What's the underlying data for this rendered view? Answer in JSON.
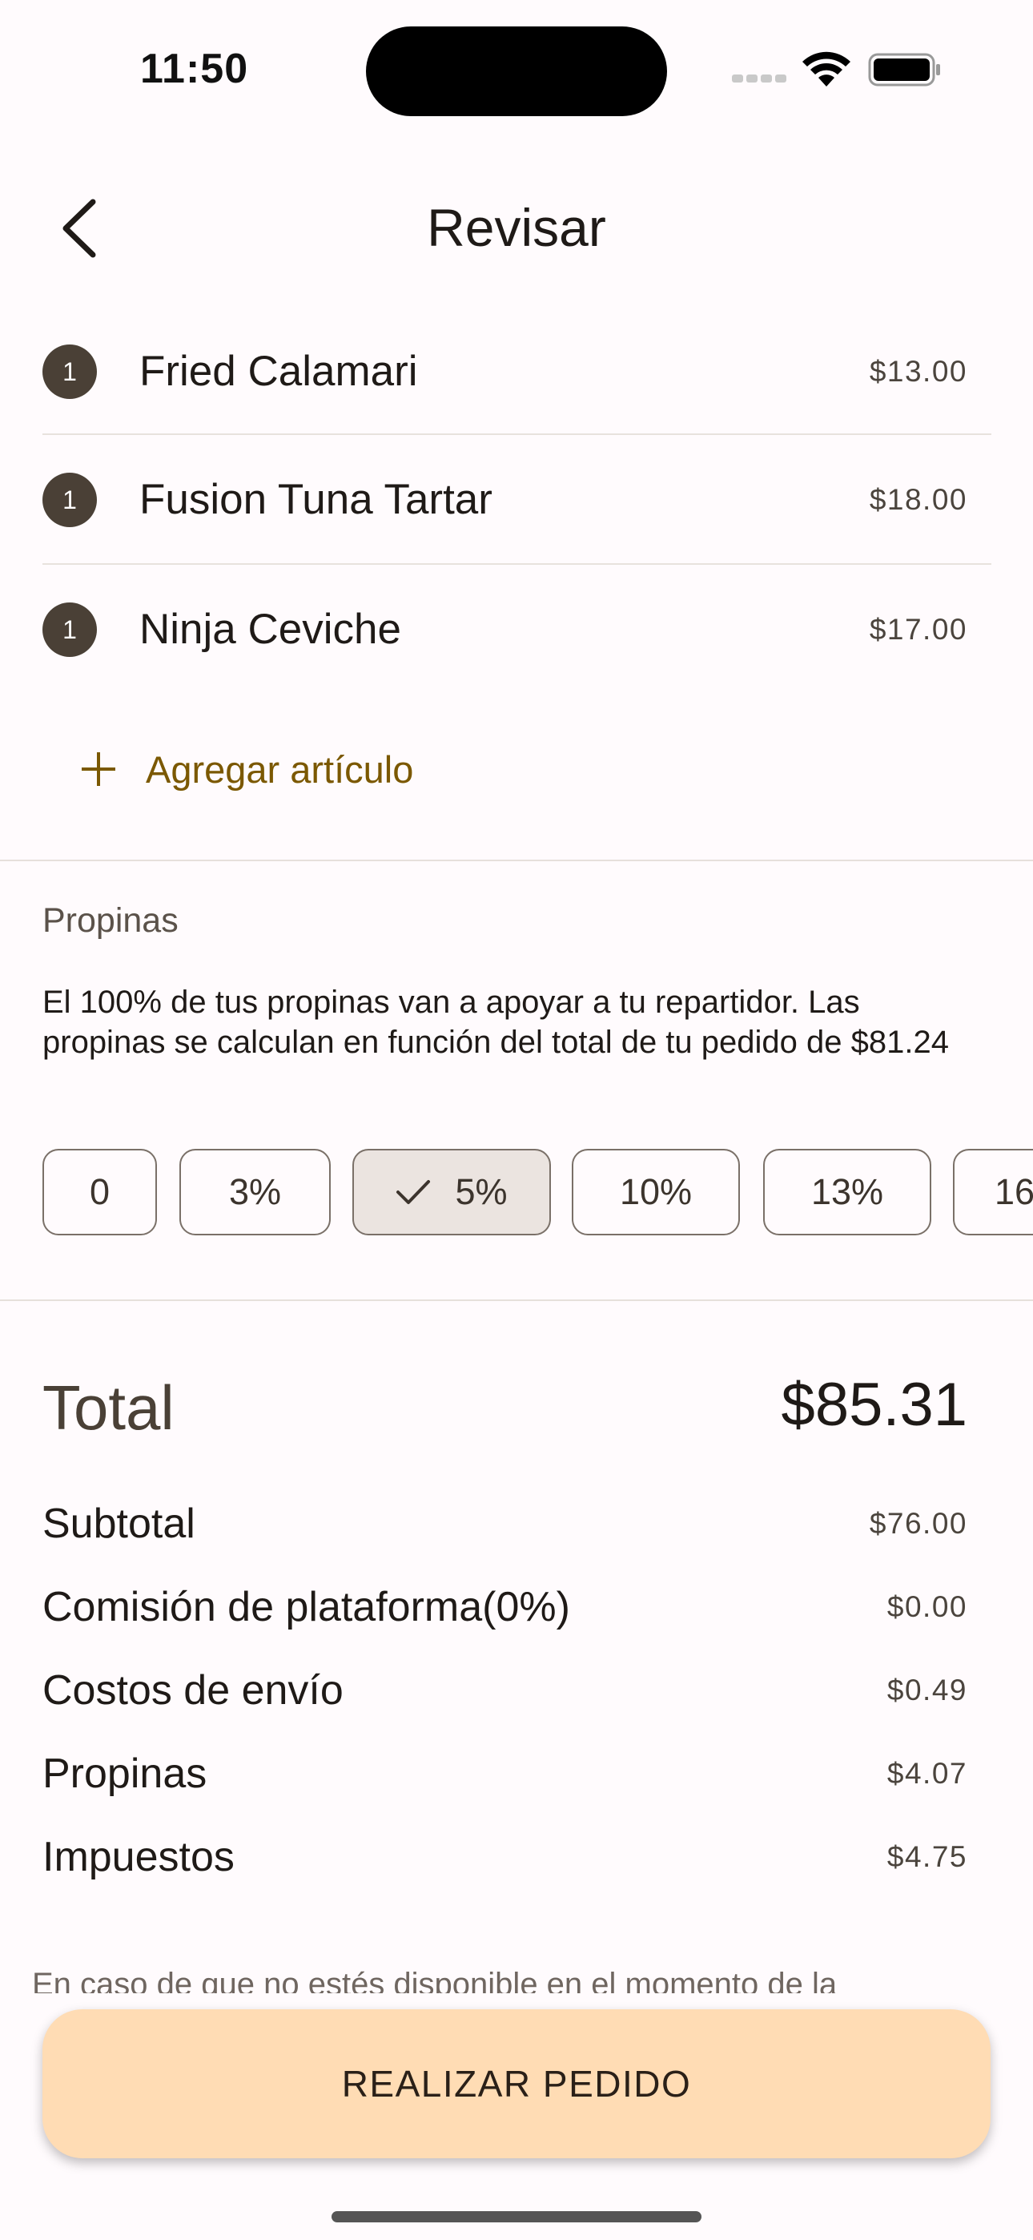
{
  "status_bar": {
    "time": "11:50"
  },
  "header": {
    "title": "Revisar"
  },
  "cart": {
    "items": [
      {
        "qty": "1",
        "name": "Fried Calamari",
        "price": "$13.00"
      },
      {
        "qty": "1",
        "name": "Fusion Tuna Tartar",
        "price": "$18.00"
      },
      {
        "qty": "1",
        "name": "Ninja Ceviche",
        "price": "$17.00"
      }
    ],
    "add_item_label": "Agregar artículo"
  },
  "tips": {
    "title": "Propinas",
    "description": "El 100% de tus propinas van a apoyar a tu repartidor. Las propinas se calculan en función del total de tu pedido de $81.24",
    "options": [
      "0",
      "3%",
      "5%",
      "10%",
      "13%",
      "16"
    ],
    "selected": "5%"
  },
  "summary": {
    "total_label": "Total",
    "total_value": "$85.31",
    "rows": [
      {
        "label": "Subtotal",
        "value": "$76.00"
      },
      {
        "label": "Comisión de plataforma(0%)",
        "value": "$0.00"
      },
      {
        "label": "Costos de envío",
        "value": "$0.49"
      },
      {
        "label": "Propinas",
        "value": "$4.07"
      },
      {
        "label": "Impuestos",
        "value": "$4.75"
      }
    ]
  },
  "footer_note": "En caso de que no estés disponible en el momento de la",
  "cta": {
    "label": "REALIZAR PEDIDO"
  },
  "colors": {
    "accent": "#7b5800",
    "cta_background": "#ffdcb4",
    "qty_badge": "#4a4036"
  }
}
